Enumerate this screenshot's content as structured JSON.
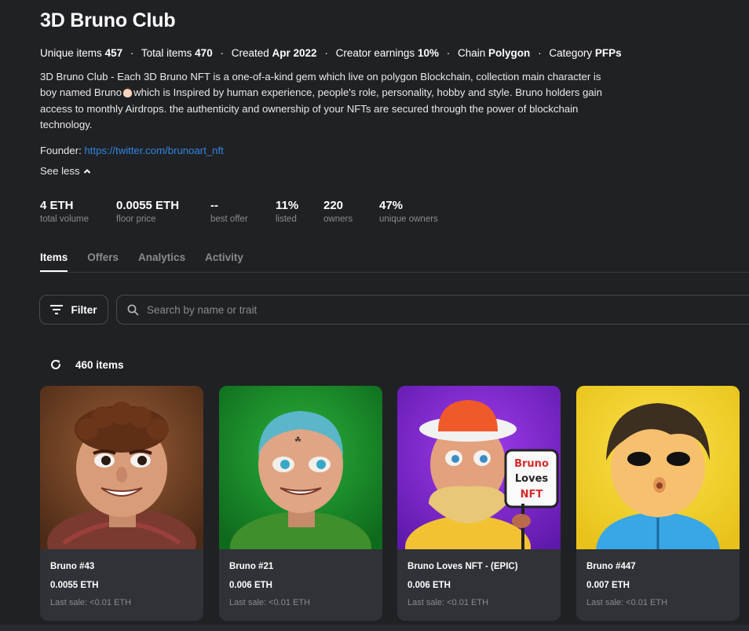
{
  "collection": {
    "title": "3D Bruno Club",
    "meta": [
      {
        "key": "Unique items",
        "value": "457"
      },
      {
        "key": "Total items",
        "value": "470"
      },
      {
        "key": "Created",
        "value": "Apr 2022"
      },
      {
        "key": "Creator earnings",
        "value": "10%"
      },
      {
        "key": "Chain",
        "value": "Polygon"
      },
      {
        "key": "Category",
        "value": "PFPs"
      }
    ],
    "description_part1": "3D Bruno Club - Each 3D Bruno NFT is a one-of-a-kind gem which live on polygon Blockchain, collection main character is boy named Bruno",
    "description_part2": "which is Inspired by human experience, people's role, personality, hobby and style. Bruno holders gain access to monthly Airdrops. the authenticity and ownership of your NFTs are secured through the power of blockchain technology.",
    "founder_label": "Founder:",
    "founder_link": "https://twitter.com/brunoart_nft",
    "see_less": "See less"
  },
  "stats": [
    {
      "value": "4 ETH",
      "label": "total volume"
    },
    {
      "value": "0.0055 ETH",
      "label": "floor price"
    },
    {
      "value": "--",
      "label": "best offer"
    },
    {
      "value": "11%",
      "label": "listed"
    },
    {
      "value": "220",
      "label": "owners"
    },
    {
      "value": "47%",
      "label": "unique owners"
    }
  ],
  "tabs": [
    "Items",
    "Offers",
    "Analytics",
    "Activity"
  ],
  "toolbar": {
    "filter_label": "Filter",
    "search_placeholder": "Search by name or trait"
  },
  "items_count": "460 items",
  "cards": [
    {
      "name": "Bruno #43",
      "price": "0.0055 ETH",
      "last_sale": "Last sale: <0.01 ETH",
      "bg": "#7a4a2c"
    },
    {
      "name": "Bruno #21",
      "price": "0.006 ETH",
      "last_sale": "Last sale: <0.01 ETH",
      "bg": "#1f8c2c"
    },
    {
      "name": "Bruno Loves NFT - (EPIC)",
      "price": "0.006 ETH",
      "last_sale": "Last sale: <0.01 ETH",
      "bg": "#8a2fd6"
    },
    {
      "name": "Bruno #447",
      "price": "0.007 ETH",
      "last_sale": "Last sale: <0.01 ETH",
      "bg": "#f2d230"
    }
  ],
  "colors": {
    "background": "#202124",
    "link": "#2f86e0",
    "muted": "#8a8b8f",
    "card": "#303237"
  },
  "icons": [
    "chevron-up-icon",
    "filter-icon",
    "search-icon",
    "refresh-icon"
  ]
}
